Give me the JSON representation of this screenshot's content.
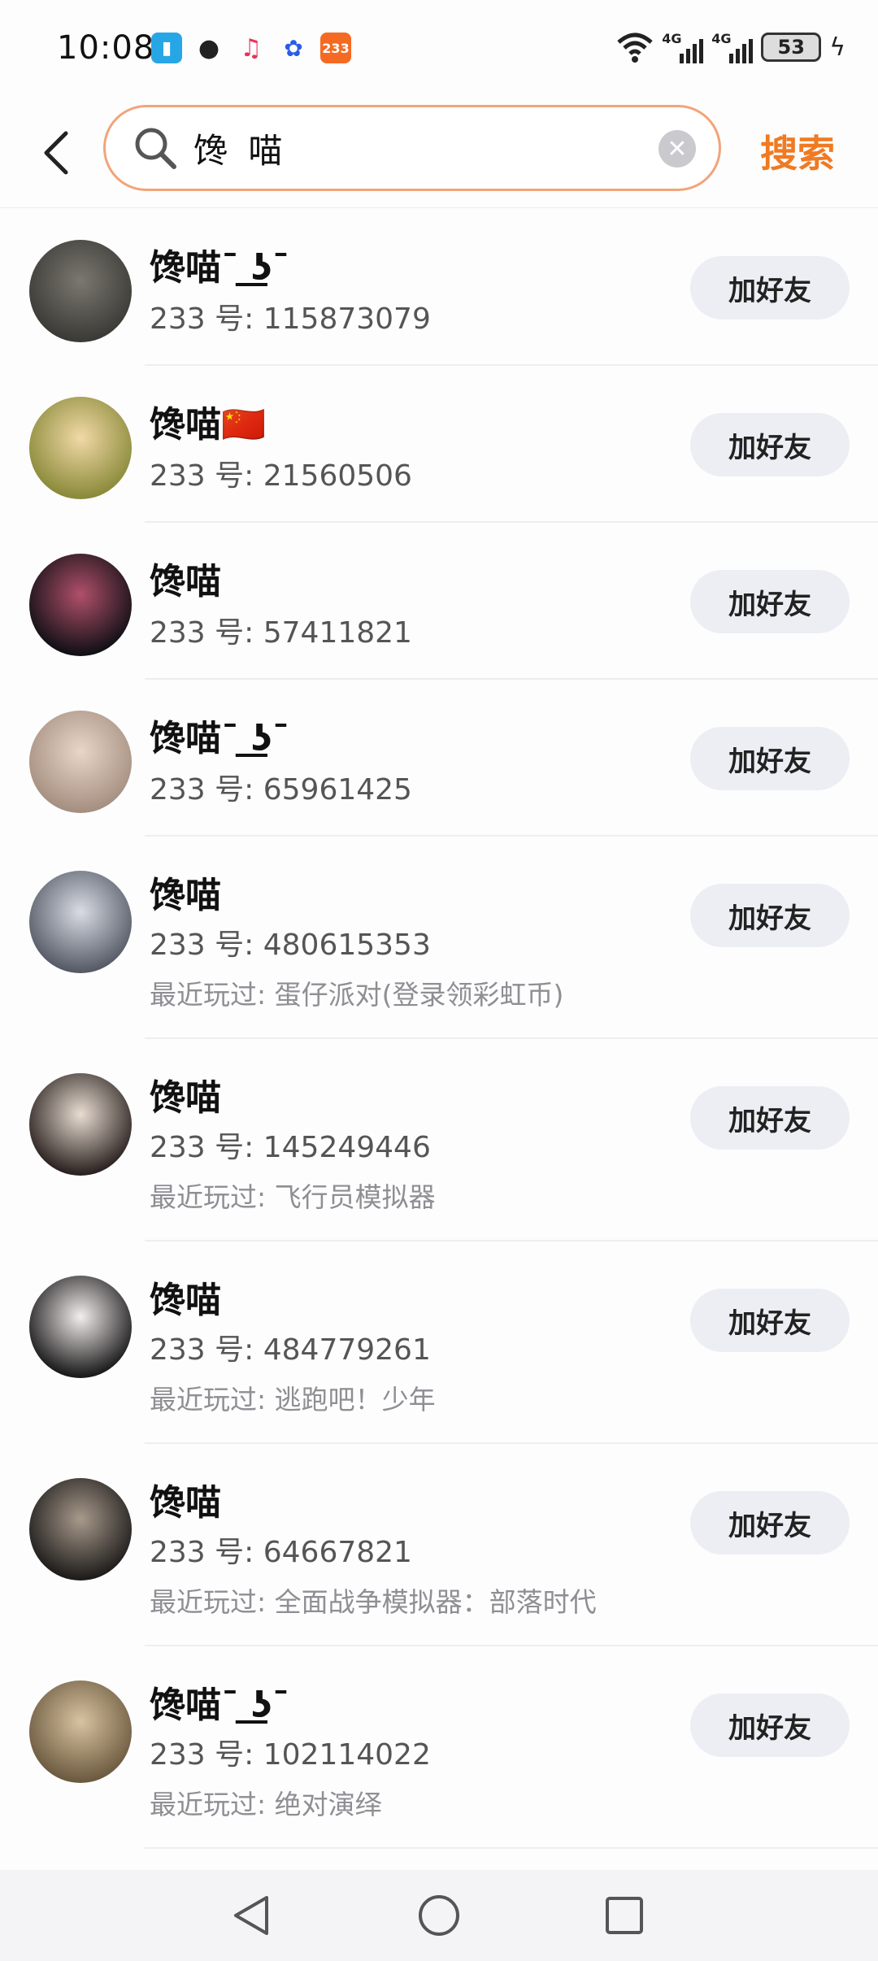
{
  "status_bar": {
    "time": "10:08",
    "notif_233": "233",
    "battery": "53",
    "net1": "4G",
    "net2": "4G"
  },
  "header": {
    "search_value": "馋 喵",
    "search_button": "搜索"
  },
  "results": [
    {
      "name": "馋喵ˉ ͟ʖˉ",
      "uid": "233 号: 115873079",
      "recent": "",
      "button": "加好友",
      "avatar_colors": [
        "#3b3a36",
        "#7a7870"
      ]
    },
    {
      "name": "馋喵🇨🇳",
      "uid": "233 号: 21560506",
      "recent": "",
      "button": "加好友",
      "avatar_colors": [
        "#8a8a3a",
        "#f1d9a6"
      ]
    },
    {
      "name": "馋喵",
      "uid": "233 号: 57411821",
      "recent": "",
      "button": "加好友",
      "avatar_colors": [
        "#111015",
        "#b0506a"
      ]
    },
    {
      "name": "馋喵ˉ ͟ʖˉ",
      "uid": "233 号: 65961425",
      "recent": "",
      "button": "加好友",
      "avatar_colors": [
        "#a58f80",
        "#e8d6c9"
      ]
    },
    {
      "name": "馋喵",
      "uid": "233 号: 480615353",
      "recent": "最近玩过: 蛋仔派对(登录领彩虹币)",
      "button": "加好友",
      "avatar_colors": [
        "#555a66",
        "#d9dce4"
      ]
    },
    {
      "name": "馋喵",
      "uid": "233 号: 145249446",
      "recent": "最近玩过: 飞行员模拟器",
      "button": "加好友",
      "avatar_colors": [
        "#2a2220",
        "#e9ddd2"
      ]
    },
    {
      "name": "馋喵",
      "uid": "233 号: 484779261",
      "recent": "最近玩过: 逃跑吧！少年",
      "button": "加好友",
      "avatar_colors": [
        "#1a1a1a",
        "#f4eeee"
      ]
    },
    {
      "name": "馋喵",
      "uid": "233 号: 64667821",
      "recent": "最近玩过: 全面战争模拟器：部落时代",
      "button": "加好友",
      "avatar_colors": [
        "#1e1c1b",
        "#a89a8c"
      ]
    },
    {
      "name": "馋喵ˉ ͟ʖˉ",
      "uid": "233 号: 102114022",
      "recent": "最近玩过: 绝对演绎",
      "button": "加好友",
      "avatar_colors": [
        "#6c5a40",
        "#d8c3a0"
      ]
    }
  ]
}
